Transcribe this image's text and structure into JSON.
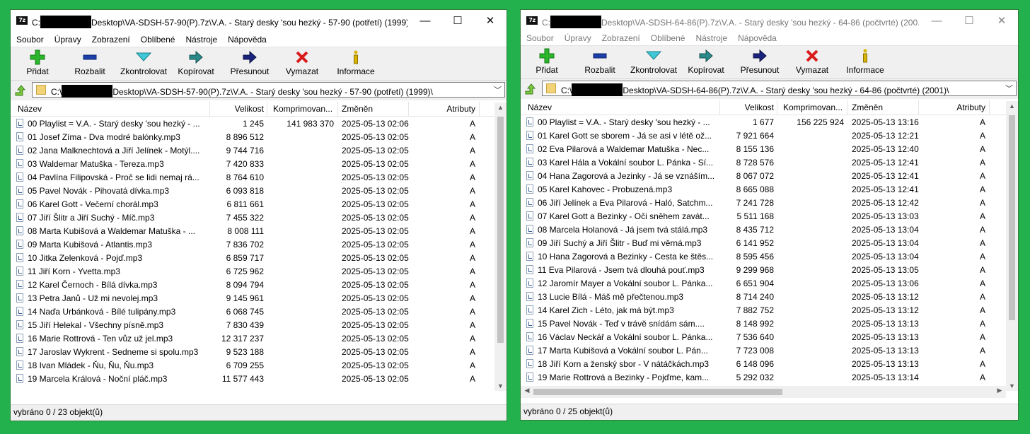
{
  "menu": [
    "Soubor",
    "Úpravy",
    "Zobrazení",
    "Oblíbené",
    "Nástroje",
    "Nápověda"
  ],
  "toolbar": [
    {
      "label": "Přidat",
      "icon": "add-icon"
    },
    {
      "label": "Rozbalit",
      "icon": "extract-icon"
    },
    {
      "label": "Zkontrolovat",
      "icon": "test-icon"
    },
    {
      "label": "Kopírovat",
      "icon": "copy-icon"
    },
    {
      "label": "Přesunout",
      "icon": "move-icon"
    },
    {
      "label": "Vymazat",
      "icon": "delete-icon"
    },
    {
      "label": "Informace",
      "icon": "info-icon"
    }
  ],
  "columns": {
    "name": "Název",
    "size": "Velikost",
    "packed": "Komprimovan...",
    "modified": "Změněn",
    "attributes": "Atributy"
  },
  "window_controls": {
    "minimize": "—",
    "maximize": "☐",
    "close": "✕"
  },
  "colors": {
    "background": "#22b14c",
    "add": "#2ab52a",
    "extract": "#1c3fa8",
    "test": "#40c8d8",
    "copy": "#2a8a8a",
    "move": "#1a237e",
    "delete": "#d81b1b",
    "info": "#d8b400"
  },
  "windows": [
    {
      "title_prefix": "C:",
      "title_suffix": "Desktop\\VA-SDSH-57-90(P).7z\\V.A. - Starý desky 'sou hezký - 57-90 (potřetí) (1999)\\",
      "path_prefix": "C:\\",
      "path_suffix": "Desktop\\VA-SDSH-57-90(P).7z\\V.A. - Starý desky 'sou hezký - 57-90 (potřetí) (1999)\\",
      "status": "vybráno 0 / 23 objekt(ů)",
      "files": [
        {
          "name": "00 Playlist = V.A. - Starý desky 'sou hezký - ...",
          "size": "1 245",
          "packed": "141 983 370",
          "modified": "2025-05-13 02:06",
          "attr": "A"
        },
        {
          "name": "01 Josef Zíma - Dva modré balónky.mp3",
          "size": "8 896 512",
          "packed": "",
          "modified": "2025-05-13 02:05",
          "attr": "A"
        },
        {
          "name": "02 Jana Malknechtová a Jiří Jelínek - Motýl....",
          "size": "9 744 716",
          "packed": "",
          "modified": "2025-05-13 02:05",
          "attr": "A"
        },
        {
          "name": "03 Waldemar Matuška - Tereza.mp3",
          "size": "7 420 833",
          "packed": "",
          "modified": "2025-05-13 02:05",
          "attr": "A"
        },
        {
          "name": "04 Pavlína Filipovská - Proč se lidi nemaj rá...",
          "size": "8 764 610",
          "packed": "",
          "modified": "2025-05-13 02:05",
          "attr": "A"
        },
        {
          "name": "05 Pavel Novák - Pihovatá dívka.mp3",
          "size": "6 093 818",
          "packed": "",
          "modified": "2025-05-13 02:05",
          "attr": "A"
        },
        {
          "name": "06 Karel Gott - Večerní chorál.mp3",
          "size": "6 811 661",
          "packed": "",
          "modified": "2025-05-13 02:05",
          "attr": "A"
        },
        {
          "name": "07 Jiří Šlitr a Jiří Suchý - Míč.mp3",
          "size": "7 455 322",
          "packed": "",
          "modified": "2025-05-13 02:05",
          "attr": "A"
        },
        {
          "name": "08 Marta Kubišová a Waldemar Matuška - ...",
          "size": "8 008 111",
          "packed": "",
          "modified": "2025-05-13 02:05",
          "attr": "A"
        },
        {
          "name": "09 Marta Kubišová - Atlantis.mp3",
          "size": "7 836 702",
          "packed": "",
          "modified": "2025-05-13 02:05",
          "attr": "A"
        },
        {
          "name": "10 Jitka Zelenková - Pojď.mp3",
          "size": "6 859 717",
          "packed": "",
          "modified": "2025-05-13 02:05",
          "attr": "A"
        },
        {
          "name": "11 Jiří Korn - Yvetta.mp3",
          "size": "6 725 962",
          "packed": "",
          "modified": "2025-05-13 02:05",
          "attr": "A"
        },
        {
          "name": "12 Karel Černoch - Bílá dívka.mp3",
          "size": "8 094 794",
          "packed": "",
          "modified": "2025-05-13 02:05",
          "attr": "A"
        },
        {
          "name": "13 Petra Janů - Už mi nevolej.mp3",
          "size": "9 145 961",
          "packed": "",
          "modified": "2025-05-13 02:05",
          "attr": "A"
        },
        {
          "name": "14 Naďa Urbánková - Bílé tulipány.mp3",
          "size": "6 068 745",
          "packed": "",
          "modified": "2025-05-13 02:05",
          "attr": "A"
        },
        {
          "name": "15 Jiří Helekal - Všechny písně.mp3",
          "size": "7 830 439",
          "packed": "",
          "modified": "2025-05-13 02:05",
          "attr": "A"
        },
        {
          "name": "16 Marie Rottrová - Ten vůz už jel.mp3",
          "size": "12 317 237",
          "packed": "",
          "modified": "2025-05-13 02:05",
          "attr": "A"
        },
        {
          "name": "17 Jaroslav Wykrent - Sedneme si spolu.mp3",
          "size": "9 523 188",
          "packed": "",
          "modified": "2025-05-13 02:05",
          "attr": "A"
        },
        {
          "name": "18 Ivan Mládek - Ňu, Ňu, Ňu.mp3",
          "size": "6 709 255",
          "packed": "",
          "modified": "2025-05-13 02:05",
          "attr": "A"
        },
        {
          "name": "19 Marcela Králová - Noční pláč.mp3",
          "size": "11 577 443",
          "packed": "",
          "modified": "2025-05-13 02:05",
          "attr": "A"
        }
      ]
    },
    {
      "title_prefix": "C:",
      "title_suffix": "Desktop\\VA-SDSH-64-86(P).7z\\V.A. - Starý desky 'sou hezký - 64-86 (počtvrté) (200...",
      "path_prefix": "C:\\",
      "path_suffix": "Desktop\\VA-SDSH-64-86(P).7z\\V.A. - Starý desky 'sou hezký - 64-86 (počtvrté) (2001)\\",
      "status": "vybráno 0 / 25 objekt(ů)",
      "files": [
        {
          "name": "00 Playlist = V.A. - Starý desky 'sou hezký - ...",
          "size": "1 677",
          "packed": "156 225 924",
          "modified": "2025-05-13 13:16",
          "attr": "A"
        },
        {
          "name": "01 Karel Gott se sborem - Já se asi v létě ož...",
          "size": "7 921 664",
          "packed": "",
          "modified": "2025-05-13 12:21",
          "attr": "A"
        },
        {
          "name": "02 Eva Pilarová a Waldemar Matuška - Nec...",
          "size": "8 155 136",
          "packed": "",
          "modified": "2025-05-13 12:40",
          "attr": "A"
        },
        {
          "name": "03 Karel Hála a Vokální soubor L. Pánka - Sí...",
          "size": "8 728 576",
          "packed": "",
          "modified": "2025-05-13 12:41",
          "attr": "A"
        },
        {
          "name": "04 Hana Zagorová a Jezinky - Já se vznáším...",
          "size": "8 067 072",
          "packed": "",
          "modified": "2025-05-13 12:41",
          "attr": "A"
        },
        {
          "name": "05 Karel Kahovec - Probuzená.mp3",
          "size": "8 665 088",
          "packed": "",
          "modified": "2025-05-13 12:41",
          "attr": "A"
        },
        {
          "name": "06 Jiří Jelínek a Eva Pilarová - Haló, Satchm...",
          "size": "7 241 728",
          "packed": "",
          "modified": "2025-05-13 12:42",
          "attr": "A"
        },
        {
          "name": "07 Karel Gott a Bezinky - Oči sněhem zavát...",
          "size": "5 511 168",
          "packed": "",
          "modified": "2025-05-13 13:03",
          "attr": "A"
        },
        {
          "name": "08 Marcela Holanová - Já jsem tvá stálá.mp3",
          "size": "8 435 712",
          "packed": "",
          "modified": "2025-05-13 13:04",
          "attr": "A"
        },
        {
          "name": "09 Jiří Suchý a Jiří Šlitr - Buď mi věrná.mp3",
          "size": "6 141 952",
          "packed": "",
          "modified": "2025-05-13 13:04",
          "attr": "A"
        },
        {
          "name": "10 Hana Zagorová a Bezinky - Cesta ke štěs...",
          "size": "8 595 456",
          "packed": "",
          "modified": "2025-05-13 13:04",
          "attr": "A"
        },
        {
          "name": "11 Eva Pilarová - Jsem tvá dlouhá pouť.mp3",
          "size": "9 299 968",
          "packed": "",
          "modified": "2025-05-13 13:05",
          "attr": "A"
        },
        {
          "name": "12 Jaromír Mayer a Vokální soubor L. Pánka...",
          "size": "6 651 904",
          "packed": "",
          "modified": "2025-05-13 13:06",
          "attr": "A"
        },
        {
          "name": "13 Lucie Bílá - Máš mě přečtenou.mp3",
          "size": "8 714 240",
          "packed": "",
          "modified": "2025-05-13 13:12",
          "attr": "A"
        },
        {
          "name": "14 Karel Zich - Léto, jak má být.mp3",
          "size": "7 882 752",
          "packed": "",
          "modified": "2025-05-13 13:12",
          "attr": "A"
        },
        {
          "name": "15 Pavel Novák - Teď v trávě snídám sám....",
          "size": "8 148 992",
          "packed": "",
          "modified": "2025-05-13 13:13",
          "attr": "A"
        },
        {
          "name": "16 Václav Neckář a Vokální soubor L. Pánka...",
          "size": "7 536 640",
          "packed": "",
          "modified": "2025-05-13 13:13",
          "attr": "A"
        },
        {
          "name": "17 Marta Kubišová a Vokální soubor L. Pán...",
          "size": "7 723 008",
          "packed": "",
          "modified": "2025-05-13 13:13",
          "attr": "A"
        },
        {
          "name": "18 Jiří Korn a ženský sbor - V nátáčkách.mp3",
          "size": "6 148 096",
          "packed": "",
          "modified": "2025-05-13 13:13",
          "attr": "A"
        },
        {
          "name": "19 Marie Rottrová a Bezinky - Pojďme, kam...",
          "size": "5 292 032",
          "packed": "",
          "modified": "2025-05-13 13:14",
          "attr": "A"
        }
      ]
    }
  ]
}
